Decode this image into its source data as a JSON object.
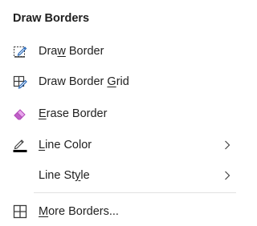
{
  "header": {
    "title": "Draw Borders"
  },
  "items": [
    {
      "pre": "Dra",
      "mn": "w",
      "post": " Border",
      "icon": "draw-border-icon"
    },
    {
      "pre": "Draw Border ",
      "mn": "G",
      "post": "rid",
      "icon": "draw-border-grid-icon"
    },
    {
      "pre": "",
      "mn": "E",
      "post": "rase Border",
      "icon": "eraser-icon"
    },
    {
      "pre": "",
      "mn": "L",
      "post": "ine Color",
      "icon": "line-color-icon",
      "submenu": true
    },
    {
      "pre": "Line St",
      "mn": "y",
      "post": "le",
      "icon": "",
      "submenu": true
    },
    {
      "pre": "",
      "mn": "M",
      "post": "ore Borders...",
      "icon": "all-borders-icon"
    }
  ],
  "colors": {
    "accent_blue": "#1a5fb4",
    "eraser_purple": "#c060c8",
    "line_color_swatch": "#000000"
  }
}
